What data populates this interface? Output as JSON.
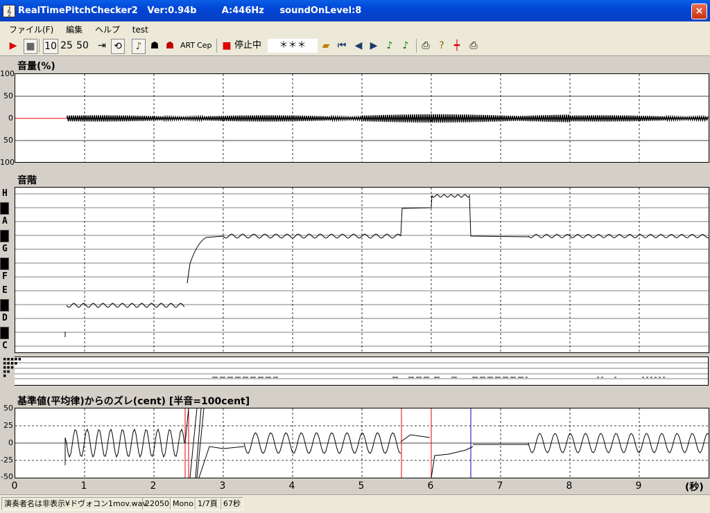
{
  "window": {
    "title": "RealTimePitchChecker2   Ver:0.94b        A:446Hz     soundOnLevel:8",
    "icon_glyph": "𝄞",
    "close_glyph": "×"
  },
  "menu": {
    "items": [
      "ファイル(F)",
      "編集",
      "ヘルプ",
      "test"
    ]
  },
  "toolbar": {
    "zoom_10": "10",
    "zoom_25": "25",
    "zoom_50": "50",
    "art": "ART",
    "cep": "Cep",
    "status_label": "停止中",
    "note_display": "＊＊＊"
  },
  "volume_panel": {
    "title": "音量(%)",
    "y_ticks": [
      "100",
      "50",
      "0",
      "50",
      "100"
    ]
  },
  "scale_panel": {
    "title": "音階",
    "notes": [
      "H",
      "A",
      "G",
      "F",
      "E",
      "D",
      "C"
    ]
  },
  "deviation_panel": {
    "title": "基準値(平均律)からのズレ(cent) [半音=100cent]",
    "y_ticks": [
      "50",
      "25",
      "0",
      "-25",
      "-50"
    ]
  },
  "x_axis": {
    "ticks": [
      "0",
      "1",
      "2",
      "3",
      "4",
      "5",
      "6",
      "7",
      "8",
      "9"
    ],
    "unit": "(秒)"
  },
  "status": {
    "file": "演奏者名は非表示¥ドヴォコン1mov.wav",
    "rate": "22050",
    "channels": "Mono",
    "page": "1/7頁",
    "duration": "67秒"
  },
  "colors": {
    "title_bar": "#0a5ee6",
    "red_marker": "#e00000",
    "blue_marker": "#0000c0"
  },
  "chart_data": [
    {
      "type": "line",
      "title": "音量(%)",
      "xlabel": "(秒)",
      "xlim": [
        0,
        10
      ],
      "ylim": [
        -100,
        100
      ],
      "grid": true,
      "series": [
        {
          "x": [
            0.7,
            10
          ],
          "amplitude": 3
        }
      ]
    },
    {
      "type": "line",
      "title": "音階",
      "xlabel": "(秒)",
      "xlim": [
        0,
        10
      ],
      "categories": [
        "C",
        "D",
        "E",
        "F",
        "G",
        "A",
        "H"
      ],
      "grid": true,
      "series": [
        {
          "segments": [
            {
              "x": [
                0.72,
                2.45
              ],
              "note": "E"
            },
            {
              "x": [
                2.5,
                3.0
              ],
              "note": "F→A"
            },
            {
              "x": [
                3.0,
                5.6
              ],
              "note": "A"
            },
            {
              "x": [
                5.6,
                6.0
              ],
              "note": "H-"
            },
            {
              "x": [
                6.0,
                6.55
              ],
              "note": "H"
            },
            {
              "x": [
                6.55,
                10
              ],
              "note": "A"
            }
          ]
        }
      ]
    },
    {
      "type": "line",
      "title": "基準値(平均律)からのズレ(cent) [半音=100cent]",
      "xlabel": "(秒)",
      "xlim": [
        0,
        10
      ],
      "ylim": [
        -50,
        50
      ],
      "grid": true,
      "markers": [
        {
          "x": 2.45,
          "color": "red"
        },
        {
          "x": 2.5,
          "color": "red"
        },
        {
          "x": 5.57,
          "color": "red"
        },
        {
          "x": 6.0,
          "color": "red"
        },
        {
          "x": 6.57,
          "color": "blue"
        }
      ],
      "series": [
        {
          "x": [
            0.72,
            10
          ],
          "oscillation_amplitude_cent": 20
        }
      ]
    }
  ]
}
